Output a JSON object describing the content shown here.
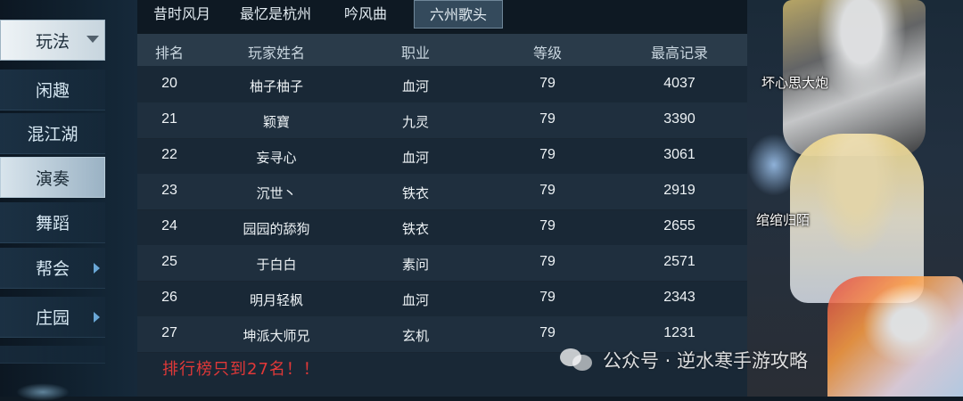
{
  "sidebar": {
    "items": [
      {
        "label": "玩法"
      },
      {
        "label": "闲趣"
      },
      {
        "label": "混江湖"
      },
      {
        "label": "演奏"
      },
      {
        "label": "舞蹈"
      },
      {
        "label": "帮会"
      },
      {
        "label": "庄园"
      }
    ]
  },
  "tabs": [
    {
      "label": "昔时风月"
    },
    {
      "label": "最忆是杭州"
    },
    {
      "label": "吟风曲"
    },
    {
      "label": "六州歌头"
    }
  ],
  "table": {
    "headers": {
      "rank": "排名",
      "name": "玩家姓名",
      "profession": "职业",
      "level": "等级",
      "record": "最高记录"
    },
    "rows": [
      {
        "rank": "20",
        "name": "柚子柚子",
        "profession": "血河",
        "level": "79",
        "record": "4037"
      },
      {
        "rank": "21",
        "name": "颖寶",
        "profession": "九灵",
        "level": "79",
        "record": "3390"
      },
      {
        "rank": "22",
        "name": "妄寻心",
        "profession": "血河",
        "level": "79",
        "record": "3061"
      },
      {
        "rank": "23",
        "name": "沉世丶",
        "profession": "铁衣",
        "level": "79",
        "record": "2919"
      },
      {
        "rank": "24",
        "name": "园园的舔狗",
        "profession": "铁衣",
        "level": "79",
        "record": "2655"
      },
      {
        "rank": "25",
        "name": "于白白",
        "profession": "素问",
        "level": "79",
        "record": "2571"
      },
      {
        "rank": "26",
        "name": "明月轻枫",
        "profession": "血河",
        "level": "79",
        "record": "2343"
      },
      {
        "rank": "27",
        "name": "坤派大师兄",
        "profession": "玄机",
        "level": "79",
        "record": "1231"
      }
    ]
  },
  "note": "排行榜只到27名！！",
  "characters": [
    {
      "name": "坏心思大炮"
    },
    {
      "name": "绾绾归陌"
    }
  ],
  "watermark": "公众号 · 逆水寒手游攻略"
}
